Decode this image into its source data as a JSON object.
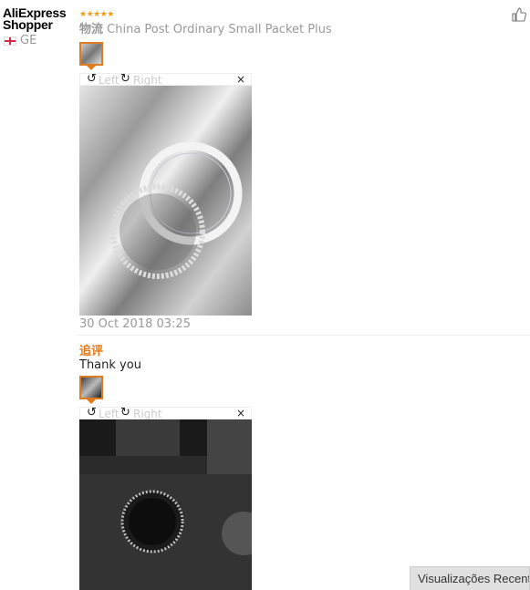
{
  "review": {
    "user": {
      "name_line1": "AliExpress",
      "name_line2": "Shopper",
      "country": "GE"
    },
    "stars": "★★★★★",
    "logistics_label": "物流",
    "logistics_value": "China Post Ordinary Small Packet Plus",
    "date": "30 Oct 2018 03:25",
    "append": {
      "label": "追评",
      "text": "Thank you"
    }
  },
  "viewer": {
    "left": "Left",
    "right": "Right",
    "close": "×"
  },
  "footer": {
    "recent_tab": "Visualizações Recent"
  }
}
